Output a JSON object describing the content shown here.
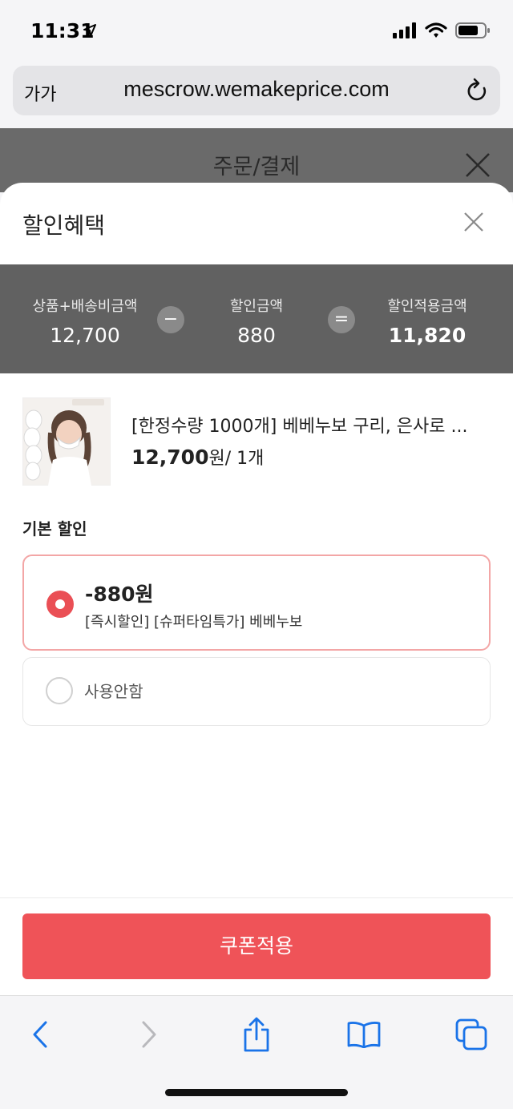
{
  "status_bar": {
    "time": "11:31"
  },
  "browser": {
    "text_size_label": "가가",
    "url": "mescrow.wemakeprice.com"
  },
  "page": {
    "title": "주문/결제"
  },
  "sheet": {
    "title": "할인혜택",
    "summary": {
      "subtotal_label": "상품+배송비금액",
      "subtotal_value": "12,700",
      "minus_symbol": "−",
      "discount_label": "할인금액",
      "discount_value": "880",
      "equals_symbol": "=",
      "total_label": "할인적용금액",
      "total_value": "11,820"
    },
    "product": {
      "name": "[한정수량 1000개] 베베누보 구리, 은사로 ...",
      "price_number": "12,700",
      "price_unit": "원",
      "quantity": "/ 1개"
    },
    "section_label": "기본 할인",
    "options": [
      {
        "amount": "-880원",
        "description": "[즉시할인] [슈퍼타임특가] 베베누보",
        "selected": true
      },
      {
        "label": "사용안함",
        "selected": false
      }
    ],
    "apply_button": "쿠폰적용"
  },
  "colors": {
    "accent": "#ef5358",
    "summary_bg": "#616161"
  },
  "toolbar": {
    "icons": [
      "back-icon",
      "forward-icon",
      "share-icon",
      "bookmarks-icon",
      "tabs-icon"
    ]
  }
}
